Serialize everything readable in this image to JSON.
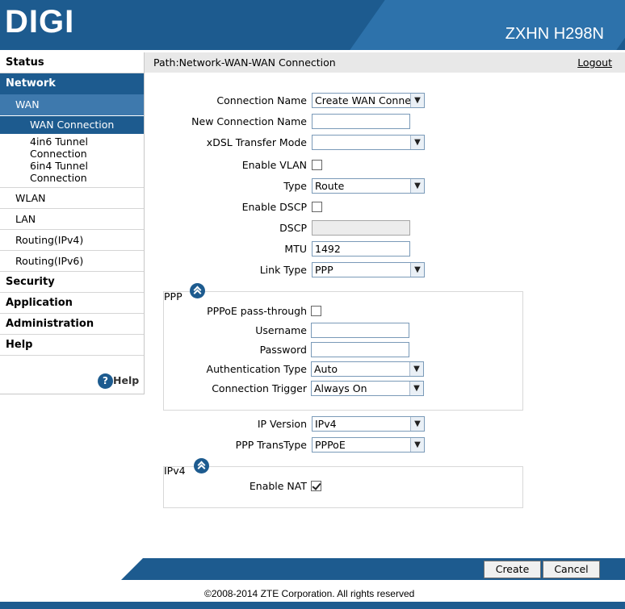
{
  "header": {
    "brand": "DIGI",
    "model": "ZXHN H298N"
  },
  "sidebar": {
    "status": "Status",
    "network": "Network",
    "wan": "WAN",
    "wan_connection": "WAN Connection",
    "tunnel_4in6": "4in6 Tunnel Connection",
    "tunnel_6in4": "6in4 Tunnel Connection",
    "wlan": "WLAN",
    "lan": "LAN",
    "routing_v4": "Routing(IPv4)",
    "routing_v6": "Routing(IPv6)",
    "security": "Security",
    "application": "Application",
    "administration": "Administration",
    "help": "Help",
    "help_link": "Help"
  },
  "pathbar": {
    "path": "Path:Network-WAN-WAN Connection",
    "logout": "Logout"
  },
  "form": {
    "connection_name": {
      "label": "Connection Name",
      "value": "Create WAN Conne"
    },
    "new_connection_name": {
      "label": "New Connection Name",
      "value": ""
    },
    "xdsl_mode": {
      "label": "xDSL Transfer Mode",
      "value": ""
    },
    "enable_vlan": {
      "label": "Enable VLAN",
      "checked": false
    },
    "type": {
      "label": "Type",
      "value": "Route"
    },
    "enable_dscp": {
      "label": "Enable DSCP",
      "checked": false
    },
    "dscp": {
      "label": "DSCP",
      "value": ""
    },
    "mtu": {
      "label": "MTU",
      "value": "1492"
    },
    "link_type": {
      "label": "Link Type",
      "value": "PPP"
    },
    "ppp": {
      "title": "PPP",
      "passthrough": {
        "label": "PPPoE pass-through",
        "checked": false
      },
      "username": {
        "label": "Username",
        "value": ""
      },
      "password": {
        "label": "Password",
        "value": ""
      },
      "auth_type": {
        "label": "Authentication Type",
        "value": "Auto"
      },
      "trigger": {
        "label": "Connection Trigger",
        "value": "Always On"
      }
    },
    "ip_version": {
      "label": "IP Version",
      "value": "IPv4"
    },
    "ppp_transtype": {
      "label": "PPP TransType",
      "value": "PPPoE"
    },
    "ipv4": {
      "title": "IPv4",
      "enable_nat": {
        "label": "Enable NAT",
        "checked": true
      }
    }
  },
  "buttons": {
    "create": "Create",
    "cancel": "Cancel"
  },
  "footer": {
    "copyright": "©2008-2014 ZTE Corporation. All rights reserved"
  },
  "colors": {
    "primary": "#1d5b8f",
    "secondary": "#3e79ad"
  },
  "icons": {
    "collapse": "chevron-double-up-icon",
    "help": "question-circle-icon",
    "dropdown": "chevron-down-icon"
  }
}
